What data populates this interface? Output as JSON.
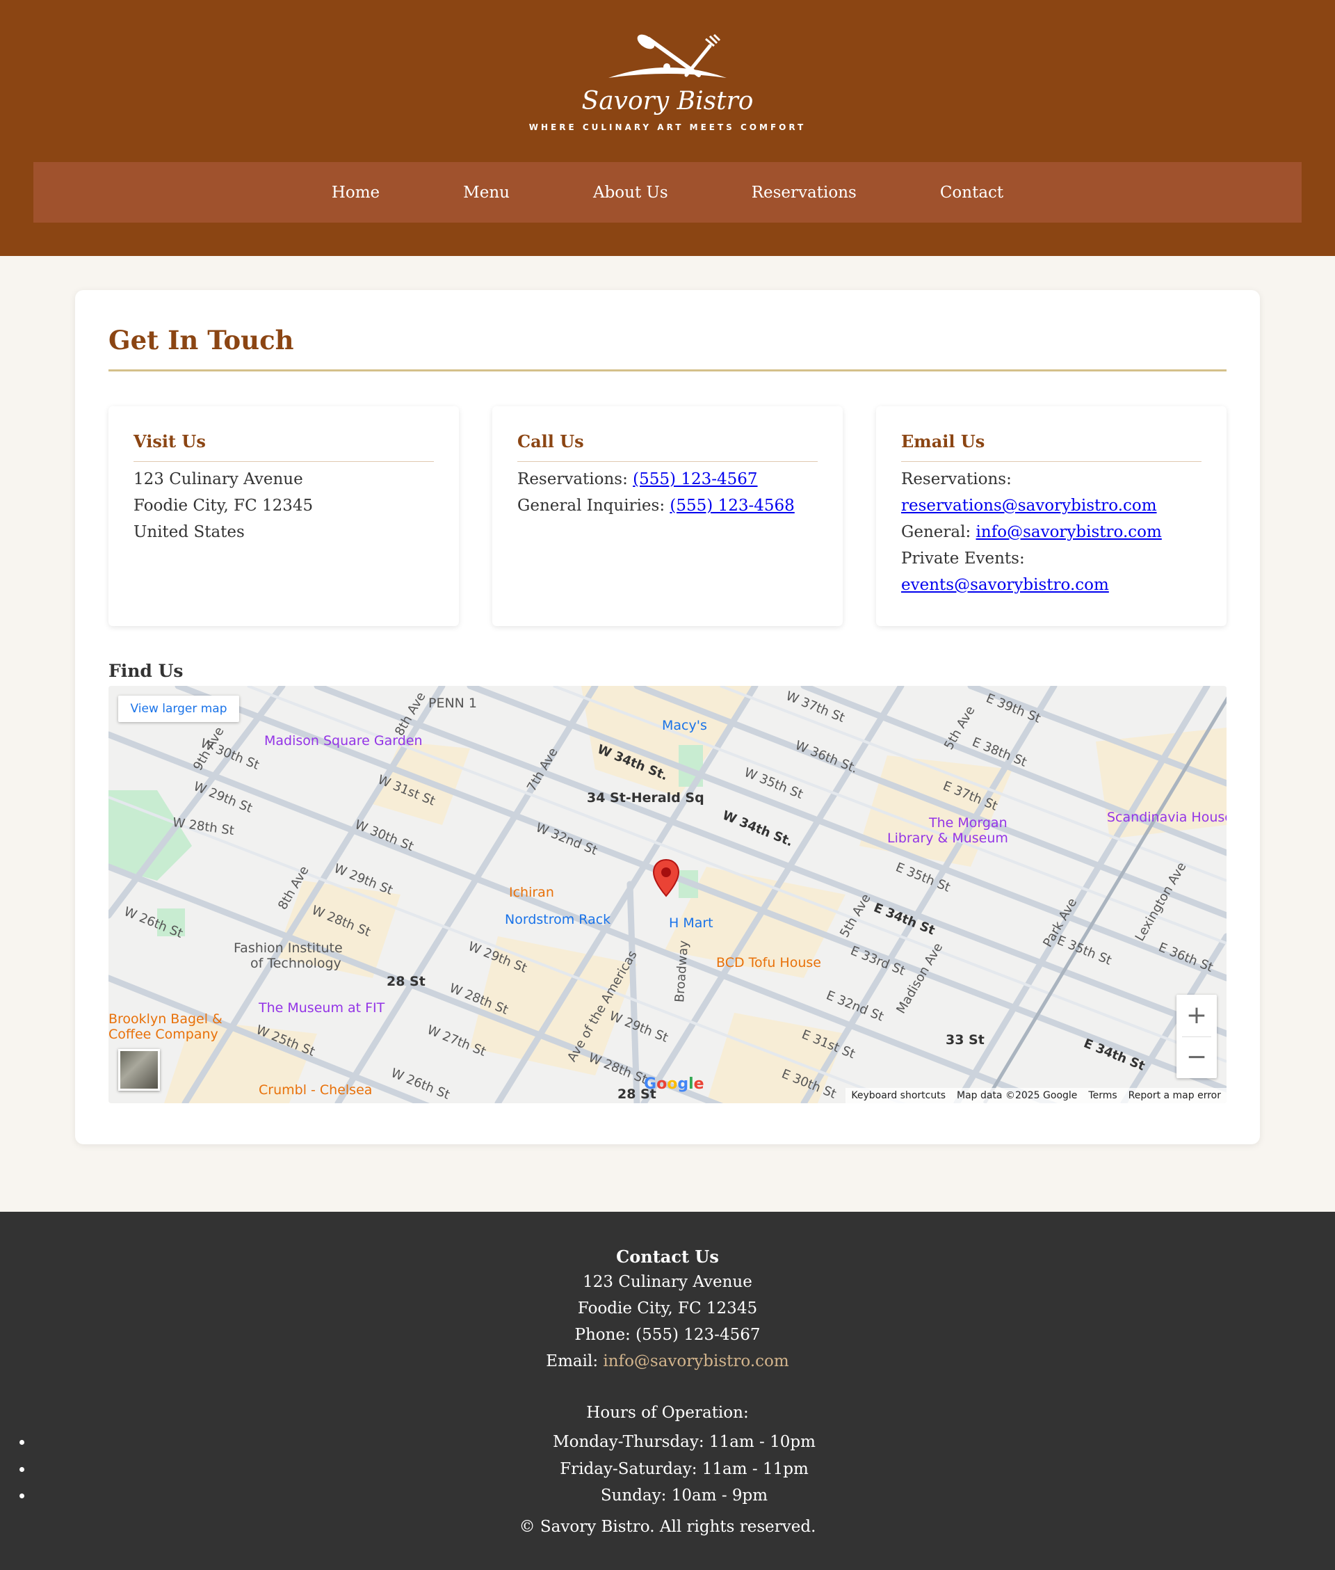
{
  "brand": {
    "name": "Savory Bistro",
    "tagline": "WHERE CULINARY ART MEETS COMFORT"
  },
  "nav": [
    "Home",
    "Menu",
    "About Us",
    "Reservations",
    "Contact"
  ],
  "contact": {
    "heading": "Get In Touch",
    "visit": {
      "title": "Visit Us",
      "line1": "123 Culinary Avenue",
      "line2": "Foodie City, FC 12345",
      "line3": "United States"
    },
    "call": {
      "title": "Call Us",
      "res_label": "Reservations:",
      "res_phone": "(555) 123-4567",
      "gen_label": "General Inquiries:",
      "gen_phone": "(555) 123-4568"
    },
    "email": {
      "title": "Email Us",
      "res_label": "Reservations:",
      "res_email": "reservations@savorybistro.com",
      "gen_label": "General:",
      "gen_email": "info@savorybistro.com",
      "priv_label": "Private Events:",
      "priv_email": "events@savorybistro.com"
    },
    "find_heading": "Find Us"
  },
  "map": {
    "larger_map": "View larger map",
    "zoom_in": "+",
    "zoom_out": "−",
    "google": "Google",
    "attribution": [
      "Keyboard shortcuts",
      "Map data ©2025 Google",
      "Terms",
      "Report a map error"
    ],
    "streets": [
      "W 30th St",
      "W 29th St",
      "W 28th St",
      "W 26th St",
      "W 31st St",
      "W 30th St",
      "W 29th St",
      "W 28th St",
      "W 34th St.",
      "W 32nd St",
      "W 29th St",
      "W 28th St",
      "W 27th St",
      "W 26th St",
      "W 25th St",
      "W 29th St",
      "W 28th St",
      "W 37th St",
      "W 36th St.",
      "W 35th St",
      "W 34th St.",
      "E 39th St",
      "E 38th St",
      "E 37th St",
      "E 35th St",
      "E 34th St",
      "E 33rd St",
      "E 32nd St",
      "E 31st St",
      "E 30th St",
      "E 35th St",
      "E 36th St",
      "E 34th St",
      "9th Ave",
      "8th Ave",
      "8th Ave",
      "7th Ave",
      "Ave of the Americas",
      "Broadway",
      "5th Ave",
      "5th Ave",
      "Madison Ave",
      "Park Ave",
      "Lexington Ave"
    ],
    "pois": {
      "penn": "PENN 1",
      "msg": "Madison Square Garden",
      "macys": "Macy's",
      "herald": "34 St-Herald Sq",
      "morgan1": "The Morgan",
      "morgan2": "Library & Museum",
      "scandinavia": "Scandinavia House",
      "ichiran": "Ichiran",
      "nordstrom": "Nordstrom Rack",
      "hmart": "H Mart",
      "bcd": "BCD Tofu House",
      "fit1": "Fashion Institute",
      "fit2": "of Technology",
      "st28": "28 St",
      "museumfit": "The Museum at FIT",
      "brooklyn1": "Brooklyn Bagel &",
      "brooklyn2": "Coffee Company",
      "crumbl": "Crumbl - Chelsea",
      "st33": "33 St",
      "st28b": "28 St"
    },
    "colors": {
      "poi_purple": "#9334e6",
      "poi_orange": "#e8710a",
      "poi_blue": "#1a73e8",
      "pin_red": "#ea4335"
    }
  },
  "footer": {
    "title": "Contact Us",
    "address1": "123 Culinary Avenue",
    "address2": "Foodie City, FC 12345",
    "phone": "Phone: (555) 123-4567",
    "email_label": "Email:",
    "email": "info@savorybistro.com",
    "hours_title": "Hours of Operation:",
    "hours": [
      "Monday-Thursday: 11am - 10pm",
      "Friday-Saturday: 11am - 11pm",
      "Sunday: 10am - 9pm"
    ],
    "copyright": "© Savory Bistro. All rights reserved."
  },
  "colors": {
    "header": "#8b4513",
    "nav": "#a0522d",
    "accent_gold": "#d4c08a",
    "footer": "#333333",
    "footer_link": "#d2b48c"
  }
}
